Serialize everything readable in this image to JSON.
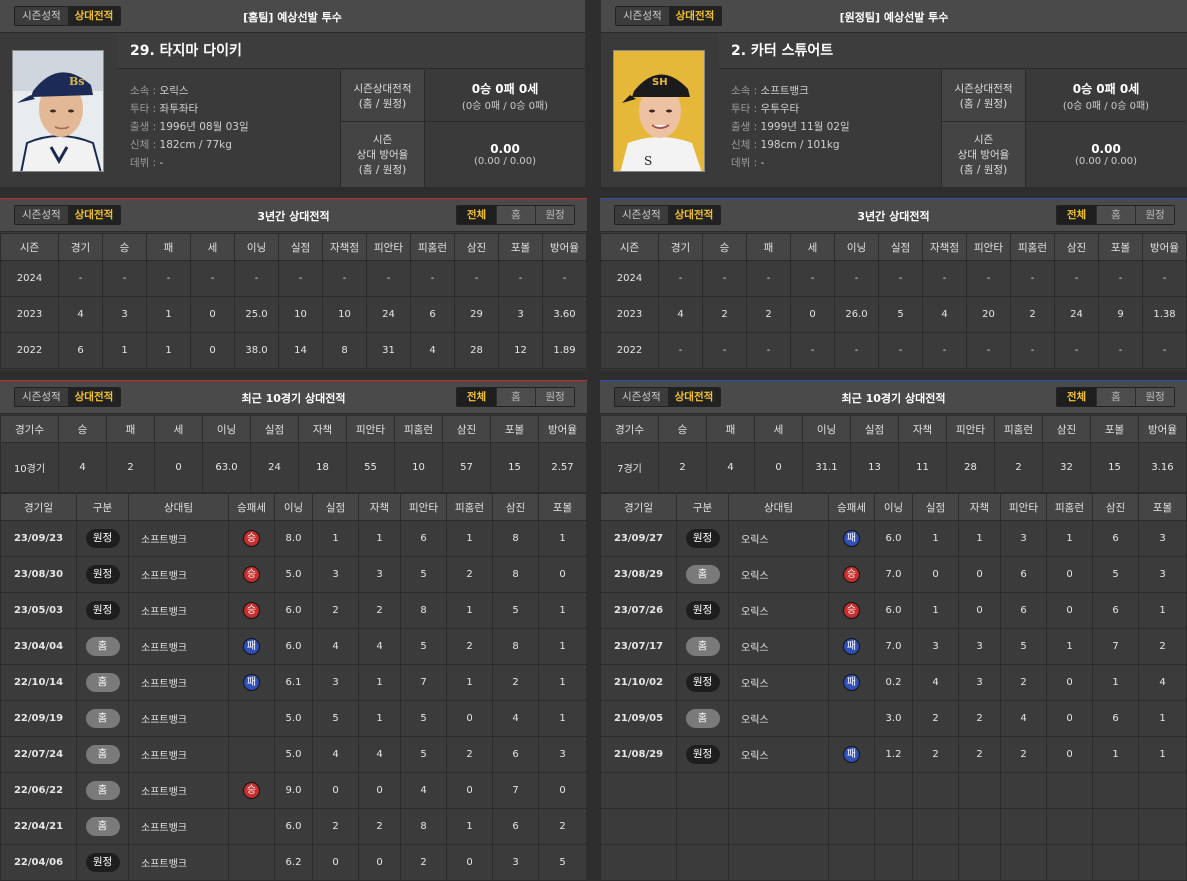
{
  "home": {
    "tabs": [
      "시즌성적",
      "상대전적"
    ],
    "header_title": "[홈팀] 예상선발 투수",
    "player": {
      "name": "29. 타지마 다이키",
      "info": [
        {
          "k": "소속",
          "v": "오릭스"
        },
        {
          "k": "투타",
          "v": "좌투좌타"
        },
        {
          "k": "출생",
          "v": "1996년 08월 03일"
        },
        {
          "k": "신체",
          "v": "182cm / 77kg"
        },
        {
          "k": "데뷔",
          "v": "-"
        }
      ],
      "record_label": [
        "시즌상대전적",
        "(홈 / 원정)"
      ],
      "record": "0승 0패 0세",
      "record_split": "(0승 0패 / 0승 0패)",
      "era_label": [
        "시즌",
        "상대 방어율",
        "(홈 / 원정)"
      ],
      "era": "0.00",
      "era_split": "(0.00 / 0.00)"
    },
    "three_year": {
      "title": "3년간 상대전적",
      "toggle": [
        "전체",
        "홈",
        "원정"
      ],
      "cols": [
        "시즌",
        "경기",
        "승",
        "패",
        "세",
        "이닝",
        "실점",
        "자책점",
        "피안타",
        "피홈런",
        "삼진",
        "포볼",
        "방어율"
      ],
      "rows": [
        [
          "2024",
          "-",
          "-",
          "-",
          "-",
          "-",
          "-",
          "-",
          "-",
          "-",
          "-",
          "-",
          "-"
        ],
        [
          "2023",
          "4",
          "3",
          "1",
          "0",
          "25.0",
          "10",
          "10",
          "24",
          "6",
          "29",
          "3",
          "3.60"
        ],
        [
          "2022",
          "6",
          "1",
          "1",
          "0",
          "38.0",
          "14",
          "8",
          "31",
          "4",
          "28",
          "12",
          "1.89"
        ]
      ]
    },
    "recent": {
      "title": "최근 10경기 상대전적",
      "toggle": [
        "전체",
        "홈",
        "원정"
      ],
      "sum_cols": [
        "경기수",
        "승",
        "패",
        "세",
        "이닝",
        "실점",
        "자책",
        "피안타",
        "피홈런",
        "삼진",
        "포볼",
        "방어율"
      ],
      "sum_row": [
        "10경기",
        "4",
        "2",
        "0",
        "63.0",
        "24",
        "18",
        "55",
        "10",
        "57",
        "15",
        "2.57"
      ],
      "game_cols": [
        "경기일",
        "구분",
        "상대팀",
        "승패세",
        "이닝",
        "실점",
        "자책",
        "피안타",
        "피홈런",
        "삼진",
        "포볼"
      ],
      "games": [
        {
          "date": "23/09/23",
          "venue": "원정",
          "team": "소프트뱅크",
          "res": "승",
          "ip": "8.0",
          "r": "1",
          "er": "1",
          "h": "6",
          "hr": "1",
          "so": "8",
          "bb": "1"
        },
        {
          "date": "23/08/30",
          "venue": "원정",
          "team": "소프트뱅크",
          "res": "승",
          "ip": "5.0",
          "r": "3",
          "er": "3",
          "h": "5",
          "hr": "2",
          "so": "8",
          "bb": "0"
        },
        {
          "date": "23/05/03",
          "venue": "원정",
          "team": "소프트뱅크",
          "res": "승",
          "ip": "6.0",
          "r": "2",
          "er": "2",
          "h": "8",
          "hr": "1",
          "so": "5",
          "bb": "1"
        },
        {
          "date": "23/04/04",
          "venue": "홈",
          "team": "소프트뱅크",
          "res": "패",
          "ip": "6.0",
          "r": "4",
          "er": "4",
          "h": "5",
          "hr": "2",
          "so": "8",
          "bb": "1"
        },
        {
          "date": "22/10/14",
          "venue": "홈",
          "team": "소프트뱅크",
          "res": "패",
          "ip": "6.1",
          "r": "3",
          "er": "1",
          "h": "7",
          "hr": "1",
          "so": "2",
          "bb": "1"
        },
        {
          "date": "22/09/19",
          "venue": "홈",
          "team": "소프트뱅크",
          "res": "",
          "ip": "5.0",
          "r": "5",
          "er": "1",
          "h": "5",
          "hr": "0",
          "so": "4",
          "bb": "1"
        },
        {
          "date": "22/07/24",
          "venue": "홈",
          "team": "소프트뱅크",
          "res": "",
          "ip": "5.0",
          "r": "4",
          "er": "4",
          "h": "5",
          "hr": "2",
          "so": "6",
          "bb": "3"
        },
        {
          "date": "22/06/22",
          "venue": "홈",
          "team": "소프트뱅크",
          "res": "승",
          "ip": "9.0",
          "r": "0",
          "er": "0",
          "h": "4",
          "hr": "0",
          "so": "7",
          "bb": "0"
        },
        {
          "date": "22/04/21",
          "venue": "홈",
          "team": "소프트뱅크",
          "res": "",
          "ip": "6.0",
          "r": "2",
          "er": "2",
          "h": "8",
          "hr": "1",
          "so": "6",
          "bb": "2"
        },
        {
          "date": "22/04/06",
          "venue": "원정",
          "team": "소프트뱅크",
          "res": "",
          "ip": "6.2",
          "r": "0",
          "er": "0",
          "h": "2",
          "hr": "0",
          "so": "3",
          "bb": "5"
        }
      ]
    }
  },
  "away": {
    "tabs": [
      "시즌성적",
      "상대전적"
    ],
    "header_title": "[원정팀] 예상선발 투수",
    "player": {
      "name": "2. 카터 스튜어트",
      "info": [
        {
          "k": "소속",
          "v": "소프트뱅크"
        },
        {
          "k": "투타",
          "v": "우투우타"
        },
        {
          "k": "출생",
          "v": "1999년 11월 02일"
        },
        {
          "k": "신체",
          "v": "198cm / 101kg"
        },
        {
          "k": "데뷔",
          "v": "-"
        }
      ],
      "record_label": [
        "시즌상대전적",
        "(홈 / 원정)"
      ],
      "record": "0승 0패 0세",
      "record_split": "(0승 0패 / 0승 0패)",
      "era_label": [
        "시즌",
        "상대 방어율",
        "(홈 / 원정)"
      ],
      "era": "0.00",
      "era_split": "(0.00 / 0.00)"
    },
    "three_year": {
      "title": "3년간 상대전적",
      "toggle": [
        "전체",
        "홈",
        "원정"
      ],
      "cols": [
        "시즌",
        "경기",
        "승",
        "패",
        "세",
        "이닝",
        "실점",
        "자책점",
        "피안타",
        "피홈런",
        "삼진",
        "포볼",
        "방어율"
      ],
      "rows": [
        [
          "2024",
          "-",
          "-",
          "-",
          "-",
          "-",
          "-",
          "-",
          "-",
          "-",
          "-",
          "-",
          "-"
        ],
        [
          "2023",
          "4",
          "2",
          "2",
          "0",
          "26.0",
          "5",
          "4",
          "20",
          "2",
          "24",
          "9",
          "1.38"
        ],
        [
          "2022",
          "-",
          "-",
          "-",
          "-",
          "-",
          "-",
          "-",
          "-",
          "-",
          "-",
          "-",
          "-"
        ]
      ]
    },
    "recent": {
      "title": "최근 10경기 상대전적",
      "toggle": [
        "전체",
        "홈",
        "원정"
      ],
      "sum_cols": [
        "경기수",
        "승",
        "패",
        "세",
        "이닝",
        "실점",
        "자책",
        "피안타",
        "피홈런",
        "삼진",
        "포볼",
        "방어율"
      ],
      "sum_row": [
        "7경기",
        "2",
        "4",
        "0",
        "31.1",
        "13",
        "11",
        "28",
        "2",
        "32",
        "15",
        "3.16"
      ],
      "game_cols": [
        "경기일",
        "구분",
        "상대팀",
        "승패세",
        "이닝",
        "실점",
        "자책",
        "피안타",
        "피홈런",
        "삼진",
        "포볼"
      ],
      "games": [
        {
          "date": "23/09/27",
          "venue": "원정",
          "team": "오릭스",
          "res": "패",
          "ip": "6.0",
          "r": "1",
          "er": "1",
          "h": "3",
          "hr": "1",
          "so": "6",
          "bb": "3"
        },
        {
          "date": "23/08/29",
          "venue": "홈",
          "team": "오릭스",
          "res": "승",
          "ip": "7.0",
          "r": "0",
          "er": "0",
          "h": "6",
          "hr": "0",
          "so": "5",
          "bb": "3"
        },
        {
          "date": "23/07/26",
          "venue": "원정",
          "team": "오릭스",
          "res": "승",
          "ip": "6.0",
          "r": "1",
          "er": "0",
          "h": "6",
          "hr": "0",
          "so": "6",
          "bb": "1"
        },
        {
          "date": "23/07/17",
          "venue": "홈",
          "team": "오릭스",
          "res": "패",
          "ip": "7.0",
          "r": "3",
          "er": "3",
          "h": "5",
          "hr": "1",
          "so": "7",
          "bb": "2"
        },
        {
          "date": "21/10/02",
          "venue": "원정",
          "team": "오릭스",
          "res": "패",
          "ip": "0.2",
          "r": "4",
          "er": "3",
          "h": "2",
          "hr": "0",
          "so": "1",
          "bb": "4"
        },
        {
          "date": "21/09/05",
          "venue": "홈",
          "team": "오릭스",
          "res": "",
          "ip": "3.0",
          "r": "2",
          "er": "2",
          "h": "4",
          "hr": "0",
          "so": "6",
          "bb": "1"
        },
        {
          "date": "21/08/29",
          "venue": "원정",
          "team": "오릭스",
          "res": "패",
          "ip": "1.2",
          "r": "2",
          "er": "2",
          "h": "2",
          "hr": "0",
          "so": "1",
          "bb": "1"
        }
      ]
    }
  }
}
